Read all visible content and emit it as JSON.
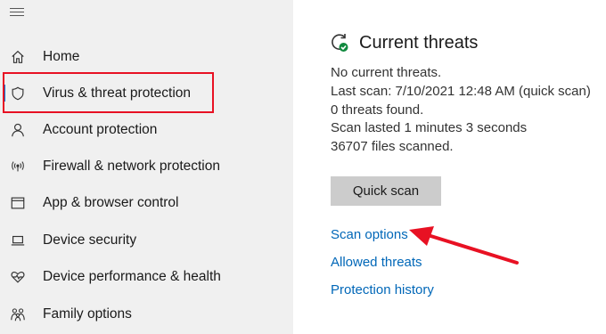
{
  "sidebar": {
    "items": [
      {
        "label": "Home",
        "icon": "home-icon"
      },
      {
        "label": "Virus & threat protection",
        "icon": "shield-icon",
        "active": true
      },
      {
        "label": "Account protection",
        "icon": "person-icon"
      },
      {
        "label": "Firewall & network protection",
        "icon": "wifi-antenna-icon"
      },
      {
        "label": "App & browser control",
        "icon": "browser-window-icon"
      },
      {
        "label": "Device security",
        "icon": "laptop-icon"
      },
      {
        "label": "Device performance & health",
        "icon": "heart-icon"
      },
      {
        "label": "Family options",
        "icon": "family-icon"
      }
    ]
  },
  "main": {
    "title": "Current threats",
    "info": {
      "status": "No current threats.",
      "last_scan": "Last scan: 7/10/2021 12:48 AM (quick scan)",
      "threats_found": "0 threats found.",
      "duration": "Scan lasted 1 minutes 3 seconds",
      "files_scanned": "36707 files scanned."
    },
    "quick_scan_label": "Quick scan",
    "links": {
      "scan_options": "Scan options",
      "allowed_threats": "Allowed threats",
      "protection_history": "Protection history"
    }
  },
  "colors": {
    "accent": "#0078d7",
    "link": "#0067b8",
    "annotation_red": "#e81123",
    "sidebar_bg": "#f0f0f0",
    "button_bg": "#cccccc"
  }
}
